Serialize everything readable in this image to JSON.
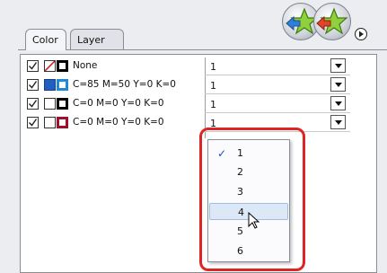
{
  "tabs": [
    {
      "label": "Color",
      "active": true
    },
    {
      "label": "Layer",
      "active": false
    }
  ],
  "rows": [
    {
      "checked": true,
      "label": "None",
      "value": "1",
      "swatch1": "none",
      "swatch2": "#000000"
    },
    {
      "checked": true,
      "label": "C=85 M=50 Y=0 K=0",
      "value": "1",
      "swatch1": "#1f5fc4",
      "swatch2": "#1f8ad8"
    },
    {
      "checked": true,
      "label": "C=0 M=0 Y=0 K=0",
      "value": "1",
      "swatch1": "#ffffff",
      "swatch2": "#000000"
    },
    {
      "checked": true,
      "label": "C=0 M=0 Y=0 K=0",
      "value": "1",
      "swatch1": "#ffffff",
      "swatch2": "#a0102a"
    }
  ],
  "dropdown": {
    "options": [
      "1",
      "2",
      "3",
      "4",
      "5",
      "6"
    ],
    "selected": "1",
    "hovered": "4"
  },
  "colors": {
    "highlight_border": "#e02424",
    "check": "#1b4fb8"
  },
  "icons": [
    "star-left-arrow-icon",
    "star-right-arrow-icon",
    "panel-menu-icon",
    "checkmark-icon",
    "chevron-down-icon",
    "mouse-pointer-icon"
  ]
}
